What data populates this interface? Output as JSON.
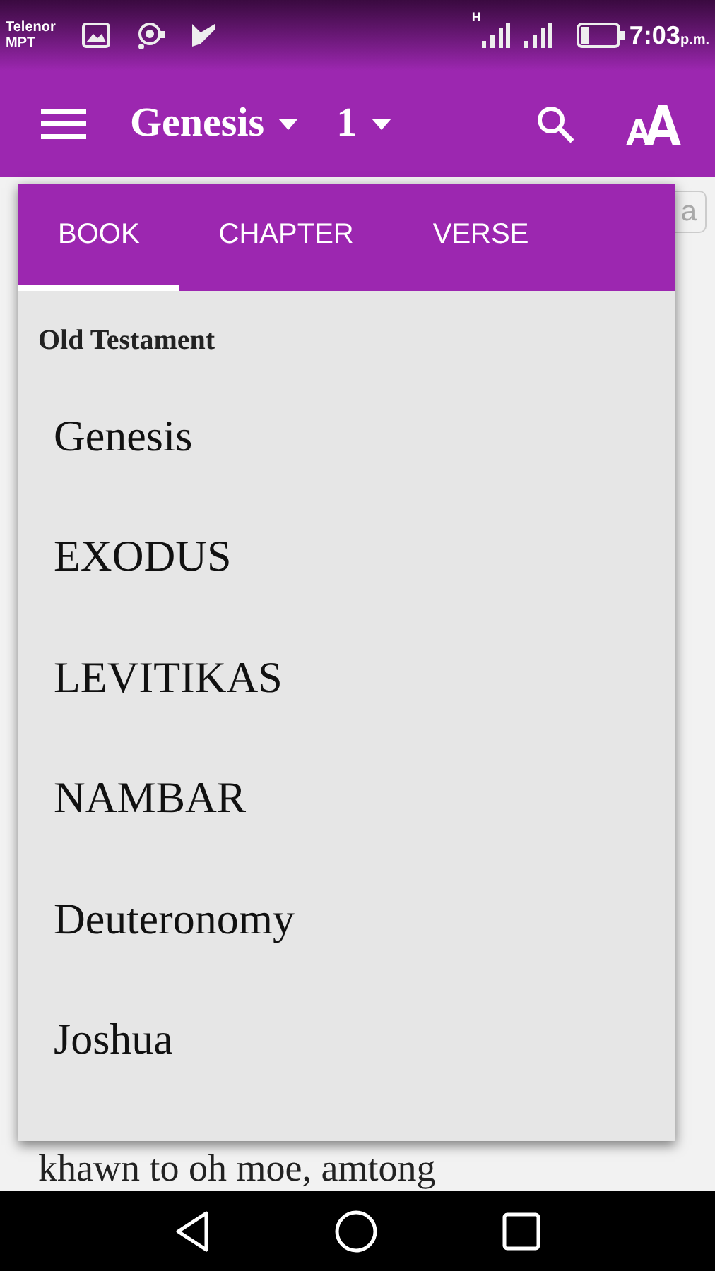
{
  "status_bar": {
    "carrier": [
      "Telenor",
      "MPT"
    ],
    "network": "H",
    "time": "7:03",
    "ampm": "p.m."
  },
  "app_bar": {
    "book": "Genesis",
    "chapter": "1"
  },
  "background": {
    "side_button": "a",
    "text": "khawn to oh moe, amtong"
  },
  "picker": {
    "tabs": [
      {
        "label": "BOOK",
        "selected": true
      },
      {
        "label": "CHAPTER",
        "selected": false
      },
      {
        "label": "VERSE",
        "selected": false
      }
    ],
    "section": "Old Testament",
    "books": [
      "Genesis",
      "EXODUS",
      "LEVITIKAS",
      "NAMBAR",
      "Deuteronomy",
      "Joshua"
    ]
  }
}
